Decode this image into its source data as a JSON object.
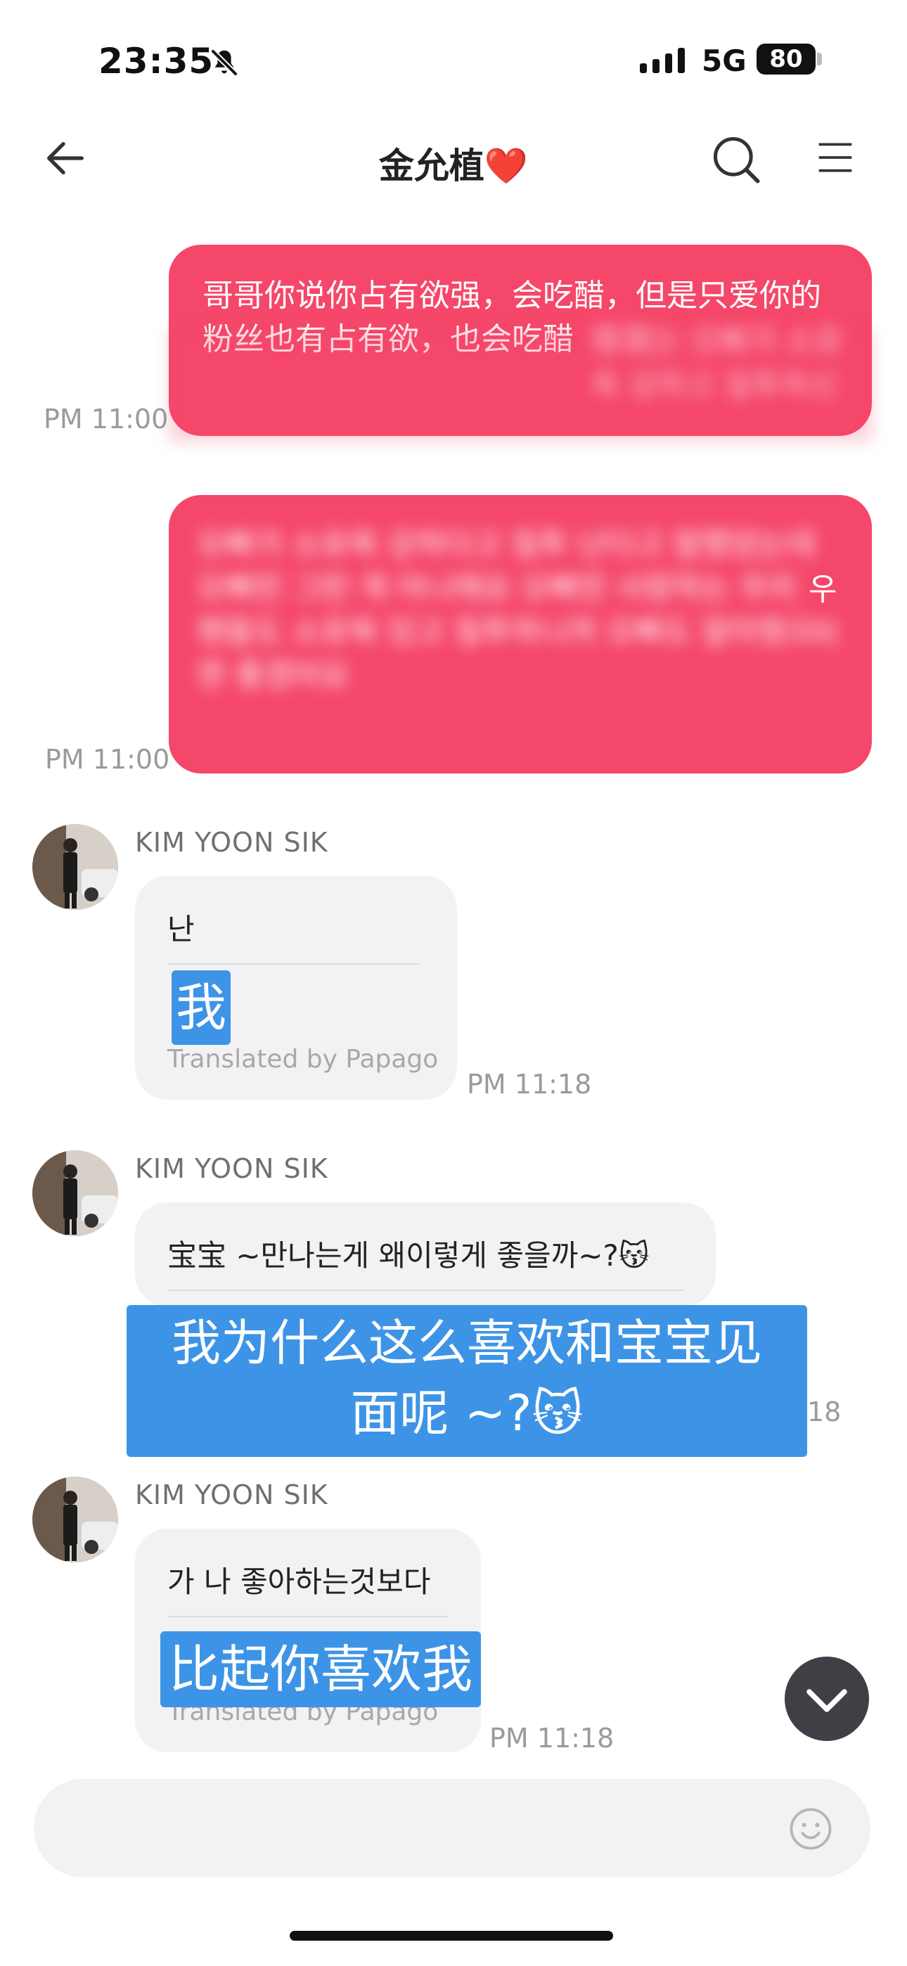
{
  "status_bar": {
    "time": "23:35",
    "network": "5G",
    "battery": "80"
  },
  "header": {
    "title": "金允植",
    "title_emoji": "❤️"
  },
  "messages": {
    "sent1": {
      "visible_text": "哥哥你说你占有欲强，会吃醋，但是只爱你的粉丝也有占有欲，也会吃醋",
      "blurred_text": "哥哥는 오빠가 소유욕 강하고 질투하신다고 하셨지만 오빠만 사랑하는 팬들도 소유욕 있고 질투해요",
      "time": "PM 11:00"
    },
    "sent2": {
      "blurred_text": "오빠가 소유욕 강하다고 질투 난다고 말했었는데 오빠만 그런 게 아니에요 오빠만 사랑하는 우리 팬들도 소유욕 있고 질투하니까 오빠도 알아줬으면 좋겠어요",
      "visible_fragment_1": "우",
      "visible_fragment_2": "이",
      "time": "PM 11:00"
    },
    "recv1": {
      "sender": "KIM YOON SIK",
      "original": "난",
      "translation": "我",
      "translated_by": "Translated by Papago",
      "time": "PM 11:18"
    },
    "recv2": {
      "sender": "KIM YOON SIK",
      "original": "宝宝 ~만나는게 왜이렇게 좋을까~?😽",
      "translation_line1": "我为什么这么喜欢和宝宝见",
      "translation_line2": "面呢 ~?😽",
      "time_fragment": "18"
    },
    "recv3": {
      "sender": "KIM YOON SIK",
      "original": "가 나 좋아하는것보다",
      "translation": "比起你喜欢我",
      "translated_by": "Translated by Papago",
      "time": "PM 11:18"
    }
  },
  "input": {
    "placeholder": ""
  },
  "icons": [
    "back-arrow-icon",
    "search-icon",
    "menu-icon",
    "bell-muted-icon",
    "chevron-down-icon",
    "emoji-icon"
  ],
  "colors": {
    "sent_bubble": "#f5476a",
    "received_bubble": "#f2f2f4",
    "highlight": "#3d94e6",
    "scroll_button": "#3e4046"
  }
}
